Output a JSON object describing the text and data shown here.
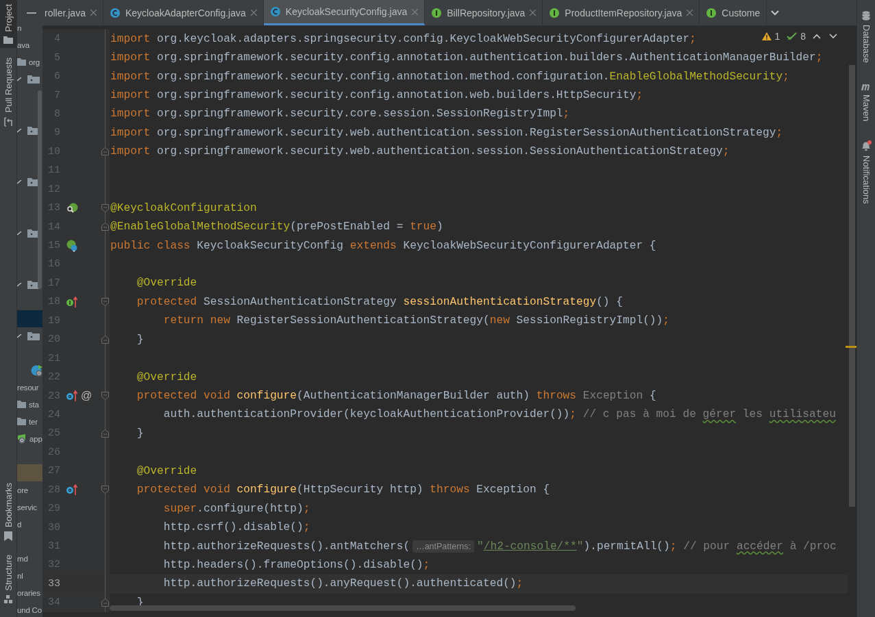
{
  "left_toolbar": {
    "top": [
      {
        "label": "Project",
        "selected": true
      },
      {
        "label": "Pull Requests",
        "selected": false
      }
    ],
    "bottom": [
      {
        "label": "Bookmarks",
        "selected": false
      },
      {
        "label": "Structure",
        "selected": false
      }
    ]
  },
  "project_tree": {
    "rows": [
      {
        "kind": "text",
        "label": "n",
        "selected": false,
        "highlighted": false
      },
      {
        "kind": "text",
        "label": "ava",
        "selected": false,
        "highlighted": false
      },
      {
        "kind": "folder",
        "label": "org",
        "selected": false,
        "highlighted": false
      },
      {
        "kind": "check-folder",
        "selected": false,
        "highlighted": false
      },
      {
        "kind": "blank",
        "selected": false,
        "highlighted": false
      },
      {
        "kind": "blank",
        "selected": false,
        "highlighted": false
      },
      {
        "kind": "check-folder",
        "selected": false,
        "highlighted": false
      },
      {
        "kind": "blank",
        "selected": false,
        "highlighted": false
      },
      {
        "kind": "blank",
        "selected": false,
        "highlighted": false
      },
      {
        "kind": "check-folder",
        "selected": false,
        "highlighted": false
      },
      {
        "kind": "blank",
        "selected": false,
        "highlighted": false
      },
      {
        "kind": "blank",
        "selected": false,
        "highlighted": false
      },
      {
        "kind": "check-folder",
        "selected": false,
        "highlighted": false
      },
      {
        "kind": "blank",
        "selected": false,
        "highlighted": false
      },
      {
        "kind": "blank",
        "selected": false,
        "highlighted": false
      },
      {
        "kind": "check-folder",
        "selected": false,
        "highlighted": false
      },
      {
        "kind": "blank",
        "selected": false,
        "highlighted": false
      },
      {
        "kind": "blank",
        "selected": true,
        "highlighted": false
      },
      {
        "kind": "check-folder",
        "selected": false,
        "highlighted": false
      },
      {
        "kind": "blank",
        "selected": false,
        "highlighted": false
      },
      {
        "kind": "spring",
        "selected": false,
        "highlighted": false
      },
      {
        "kind": "text",
        "label": "resour",
        "selected": false,
        "highlighted": false
      },
      {
        "kind": "folder",
        "label": "sta",
        "selected": false,
        "highlighted": false
      },
      {
        "kind": "folder",
        "label": "ter",
        "selected": false,
        "highlighted": false
      },
      {
        "kind": "spring-file",
        "label": "app",
        "selected": false,
        "highlighted": false
      },
      {
        "kind": "blank",
        "selected": false,
        "highlighted": false
      },
      {
        "kind": "blank",
        "selected": false,
        "highlighted": true
      },
      {
        "kind": "text",
        "label": "ore",
        "selected": false,
        "highlighted": false
      },
      {
        "kind": "text",
        "label": "servic",
        "selected": false,
        "highlighted": false
      },
      {
        "kind": "text",
        "label": "d",
        "selected": false,
        "highlighted": false
      },
      {
        "kind": "blank",
        "selected": false,
        "highlighted": false
      },
      {
        "kind": "text",
        "label": "md",
        "selected": false,
        "highlighted": false
      },
      {
        "kind": "text",
        "label": "nl",
        "selected": false,
        "highlighted": false
      },
      {
        "kind": "text",
        "label": "oraries",
        "selected": false,
        "highlighted": false
      },
      {
        "kind": "text",
        "label": "und Co",
        "selected": false,
        "highlighted": false
      }
    ]
  },
  "tabs": [
    {
      "label": "roller.java",
      "kind": "plain",
      "selected": false,
      "closable": true
    },
    {
      "label": "KeycloakAdapterConfig.java",
      "kind": "class",
      "selected": false,
      "closable": true
    },
    {
      "label": "KeycloakSecurityConfig.java",
      "kind": "class",
      "selected": true,
      "closable": true
    },
    {
      "label": "BillRepository.java",
      "kind": "interface",
      "selected": false,
      "closable": true
    },
    {
      "label": "ProductItemRepository.java",
      "kind": "interface",
      "selected": false,
      "closable": true
    },
    {
      "label": "Custome",
      "kind": "interface",
      "selected": false,
      "closable": false
    }
  ],
  "inspections": {
    "warnings": "1",
    "ok": "8"
  },
  "editor": {
    "lines": [
      {
        "number": "4",
        "current": false,
        "tokens": [
          {
            "text": "import",
            "kind": "keyword"
          },
          {
            "text": " org.keycloak.adapters.springsecurity.config.KeycloakWebSecurityConfigurerAdapter",
            "kind": "plain"
          },
          {
            "text": ";",
            "kind": "keyword"
          }
        ]
      },
      {
        "number": "5",
        "current": false,
        "tokens": [
          {
            "text": "import",
            "kind": "keyword"
          },
          {
            "text": " org.springframework.security.config.annotation.authentication.builders.AuthenticationManagerBuilder",
            "kind": "plain"
          },
          {
            "text": ";",
            "kind": "keyword"
          }
        ]
      },
      {
        "number": "6",
        "current": false,
        "tokens": [
          {
            "text": "import",
            "kind": "keyword"
          },
          {
            "text": " org.springframework.security.config.annotation.method.configuration.",
            "kind": "plain"
          },
          {
            "text": "EnableGlobalMethodSecurity",
            "kind": "annotation"
          },
          {
            "text": ";",
            "kind": "keyword"
          }
        ]
      },
      {
        "number": "7",
        "current": false,
        "tokens": [
          {
            "text": "import",
            "kind": "keyword"
          },
          {
            "text": " org.springframework.security.config.annotation.web.builders.HttpSecurity",
            "kind": "plain"
          },
          {
            "text": ";",
            "kind": "keyword"
          }
        ]
      },
      {
        "number": "8",
        "current": false,
        "tokens": [
          {
            "text": "import",
            "kind": "keyword"
          },
          {
            "text": " org.springframework.security.core.session.SessionRegistryImpl",
            "kind": "plain"
          },
          {
            "text": ";",
            "kind": "keyword"
          }
        ]
      },
      {
        "number": "9",
        "current": false,
        "tokens": [
          {
            "text": "import",
            "kind": "keyword"
          },
          {
            "text": " org.springframework.security.web.authentication.session.RegisterSessionAuthenticationStrategy",
            "kind": "plain"
          },
          {
            "text": ";",
            "kind": "keyword"
          }
        ]
      },
      {
        "number": "10",
        "current": false,
        "fold": {
          "kind": "end"
        },
        "tokens": [
          {
            "text": "import",
            "kind": "keyword"
          },
          {
            "text": " org.springframework.security.web.authentication.session.SessionAuthenticationStrategy",
            "kind": "plain"
          },
          {
            "text": ";",
            "kind": "keyword"
          }
        ]
      },
      {
        "number": "11",
        "current": false
      },
      {
        "number": "12",
        "current": false
      },
      {
        "number": "13",
        "current": false,
        "gutter": [
          {
            "kind": "spring-search"
          }
        ],
        "fold": {
          "kind": "start"
        },
        "tokens": [
          {
            "text": "@KeycloakConfiguration",
            "kind": "annotation"
          }
        ]
      },
      {
        "number": "14",
        "current": false,
        "fold": {
          "kind": "end"
        },
        "tokens": [
          {
            "text": "@EnableGlobalMethodSecurity",
            "kind": "annotation"
          },
          {
            "text": "(prePostEnabled = ",
            "kind": "plain"
          },
          {
            "text": "true",
            "kind": "keyword"
          },
          {
            "text": ")",
            "kind": "plain"
          }
        ]
      },
      {
        "number": "15",
        "current": false,
        "gutter": [
          {
            "kind": "spring-bean"
          }
        ],
        "tokens": [
          {
            "text": "public class ",
            "kind": "keyword"
          },
          {
            "text": "KeycloakSecurityConfig ",
            "kind": "plain"
          },
          {
            "text": "extends ",
            "kind": "keyword"
          },
          {
            "text": "KeycloakWebSecurityConfigurerAdapter {",
            "kind": "plain"
          }
        ]
      },
      {
        "number": "16",
        "current": false
      },
      {
        "number": "17",
        "current": false,
        "tokens": [
          {
            "text": "    @Override",
            "kind": "annotation"
          }
        ]
      },
      {
        "number": "18",
        "current": false,
        "gutter": [
          {
            "kind": "implements-up"
          }
        ],
        "fold": {
          "kind": "start"
        },
        "tokens": [
          {
            "text": "    protected ",
            "kind": "keyword"
          },
          {
            "text": "SessionAuthenticationStrategy ",
            "kind": "plain"
          },
          {
            "text": "sessionAuthenticationStrategy",
            "kind": "method"
          },
          {
            "text": "() {",
            "kind": "plain"
          }
        ]
      },
      {
        "number": "19",
        "current": false,
        "tokens": [
          {
            "text": "        return new ",
            "kind": "keyword"
          },
          {
            "text": "RegisterSessionAuthenticationStrategy(",
            "kind": "plain"
          },
          {
            "text": "new ",
            "kind": "keyword"
          },
          {
            "text": "SessionRegistryImpl())",
            "kind": "plain"
          },
          {
            "text": ";",
            "kind": "keyword"
          }
        ]
      },
      {
        "number": "20",
        "current": false,
        "fold": {
          "kind": "end"
        },
        "tokens": [
          {
            "text": "    }",
            "kind": "plain"
          }
        ]
      },
      {
        "number": "21",
        "current": false
      },
      {
        "number": "22",
        "current": false,
        "tokens": [
          {
            "text": "    @Override",
            "kind": "annotation"
          }
        ]
      },
      {
        "number": "23",
        "current": false,
        "gutter": [
          {
            "kind": "overrides-up"
          }
        ],
        "marker": "@",
        "fold": {
          "kind": "start"
        },
        "tokens": [
          {
            "text": "    protected void ",
            "kind": "keyword"
          },
          {
            "text": "configure",
            "kind": "method"
          },
          {
            "text": "(AuthenticationManagerBuilder auth) ",
            "kind": "plain"
          },
          {
            "text": "throws ",
            "kind": "keyword"
          },
          {
            "text": "Exception",
            "kind": "unused"
          },
          {
            "text": " {",
            "kind": "plain"
          }
        ]
      },
      {
        "number": "24",
        "current": false,
        "tokens": [
          {
            "text": "        auth.authenticationProvider(keycloakAuthenticationProvider())",
            "kind": "plain"
          },
          {
            "text": ";",
            "kind": "keyword"
          },
          {
            "text": " // c pas à moi de ",
            "kind": "comment"
          },
          {
            "text": "gérer",
            "kind": "typo"
          },
          {
            "text": " les ",
            "kind": "comment"
          },
          {
            "text": "utilisateu",
            "kind": "typo"
          }
        ]
      },
      {
        "number": "25",
        "current": false,
        "fold": {
          "kind": "end"
        },
        "tokens": [
          {
            "text": "    }",
            "kind": "plain"
          }
        ]
      },
      {
        "number": "26",
        "current": false
      },
      {
        "number": "27",
        "current": false,
        "tokens": [
          {
            "text": "    @Override",
            "kind": "annotation"
          }
        ]
      },
      {
        "number": "28",
        "current": false,
        "gutter": [
          {
            "kind": "overrides-up"
          }
        ],
        "fold": {
          "kind": "start"
        },
        "tokens": [
          {
            "text": "    protected void ",
            "kind": "keyword"
          },
          {
            "text": "configure",
            "kind": "method"
          },
          {
            "text": "(HttpSecurity http) ",
            "kind": "plain"
          },
          {
            "text": "throws ",
            "kind": "keyword"
          },
          {
            "text": "Exception {",
            "kind": "plain"
          }
        ]
      },
      {
        "number": "29",
        "current": false,
        "tokens": [
          {
            "text": "        super",
            "kind": "keyword"
          },
          {
            "text": ".configure(http)",
            "kind": "plain"
          },
          {
            "text": ";",
            "kind": "keyword"
          }
        ]
      },
      {
        "number": "30",
        "current": false,
        "tokens": [
          {
            "text": "        http.csrf().disable()",
            "kind": "plain"
          },
          {
            "text": ";",
            "kind": "keyword"
          }
        ]
      },
      {
        "number": "31",
        "current": false,
        "tokens": [
          {
            "text": "        http.authorizeRequests().antMatchers(",
            "kind": "plain"
          },
          {
            "text": "…antPatterns:",
            "kind": "hint"
          },
          {
            "text": "\"",
            "kind": "string"
          },
          {
            "text": "/h2-console/**",
            "kind": "reference"
          },
          {
            "text": "\"",
            "kind": "string"
          },
          {
            "text": ").permitAll()",
            "kind": "plain"
          },
          {
            "text": ";",
            "kind": "keyword"
          },
          {
            "text": " // pour ",
            "kind": "comment"
          },
          {
            "text": "accéder",
            "kind": "typo"
          },
          {
            "text": " à /proc",
            "kind": "comment"
          }
        ]
      },
      {
        "number": "32",
        "current": false,
        "tokens": [
          {
            "text": "        http.headers().frameOptions().disable()",
            "kind": "plain"
          },
          {
            "text": ";",
            "kind": "keyword"
          }
        ]
      },
      {
        "number": "33",
        "current": true,
        "tokens": [
          {
            "text": "        http.authorizeRequests().anyRequest().authenticated()",
            "kind": "plain"
          },
          {
            "text": ";",
            "kind": "keyword"
          }
        ]
      },
      {
        "number": "34",
        "current": false,
        "fold": {
          "kind": "end"
        },
        "tokens": [
          {
            "text": "    }",
            "kind": "plain"
          }
        ]
      }
    ]
  },
  "right_toolbar": [
    {
      "label": "Database"
    },
    {
      "label": "Maven"
    },
    {
      "label": "Notifications"
    }
  ]
}
